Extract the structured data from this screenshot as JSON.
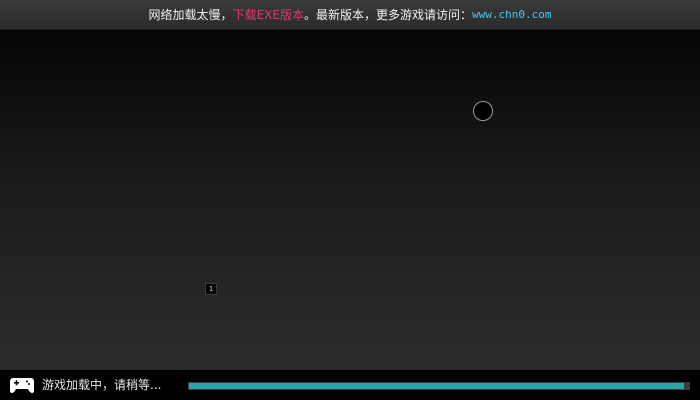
{
  "notice": {
    "prefix": "网络加载太慢，",
    "download_link": "下载EXE版本",
    "middle": "。最新版本，更多游戏请访问：",
    "site_link": "www.chn0.com",
    "highlight_color": "#e03a6b",
    "link_color": "#44c8f2"
  },
  "game": {
    "badge_number": "1"
  },
  "loading": {
    "icon": "gamepad-icon",
    "text": "游戏加载中，请稍等...",
    "progress": 0.99,
    "bar_color": "#2aa3ae"
  }
}
